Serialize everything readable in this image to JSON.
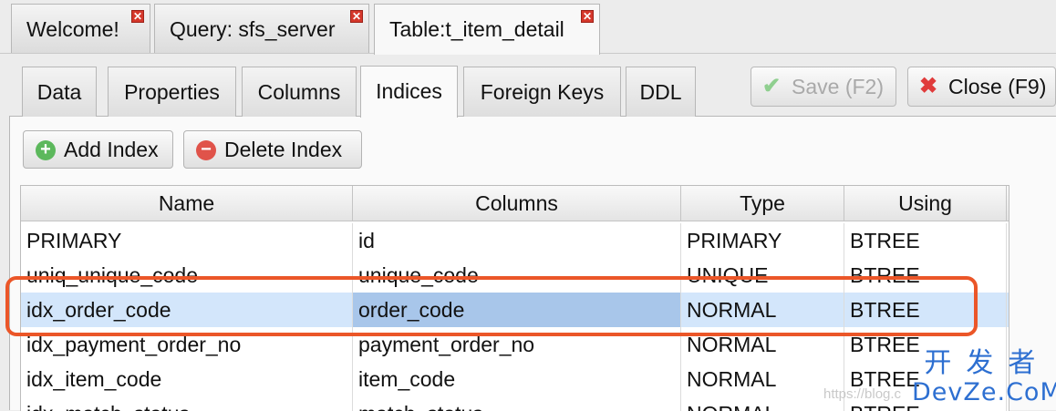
{
  "doc_tabs": [
    {
      "label": "Welcome!"
    },
    {
      "label": "Query: sfs_server"
    },
    {
      "label": "Table:t_item_detail"
    }
  ],
  "close_glyph": "✕",
  "sub_tabs": [
    {
      "label": "Data"
    },
    {
      "label": "Properties"
    },
    {
      "label": "Columns"
    },
    {
      "label": "Indices"
    },
    {
      "label": "Foreign Keys"
    },
    {
      "label": "DDL"
    }
  ],
  "toolbar": {
    "save_label": "Save (F2)",
    "close_label": "Close (F9)"
  },
  "actions": {
    "add_index_label": "Add Index",
    "delete_index_label": "Delete Index"
  },
  "grid": {
    "headers": [
      "Name",
      "Columns",
      "Type",
      "Using"
    ],
    "rows": [
      {
        "name": "PRIMARY",
        "columns": "id",
        "type": "PRIMARY",
        "using": "BTREE"
      },
      {
        "name": "uniq_unique_code",
        "columns": "unique_code",
        "type": "UNIQUE",
        "using": "BTREE"
      },
      {
        "name": "idx_order_code",
        "columns": "order_code",
        "type": "NORMAL",
        "using": "BTREE"
      },
      {
        "name": "idx_payment_order_no",
        "columns": "payment_order_no",
        "type": "NORMAL",
        "using": "BTREE"
      },
      {
        "name": "idx_item_code",
        "columns": "item_code",
        "type": "NORMAL",
        "using": "BTREE"
      },
      {
        "name": "idx_match_status",
        "columns": "match_status",
        "type": "NORMAL",
        "using": "BTREE"
      }
    ]
  },
  "watermark": {
    "url": "https://blog.c",
    "chinese": "开发者",
    "brand": "DevZe.CoM"
  }
}
